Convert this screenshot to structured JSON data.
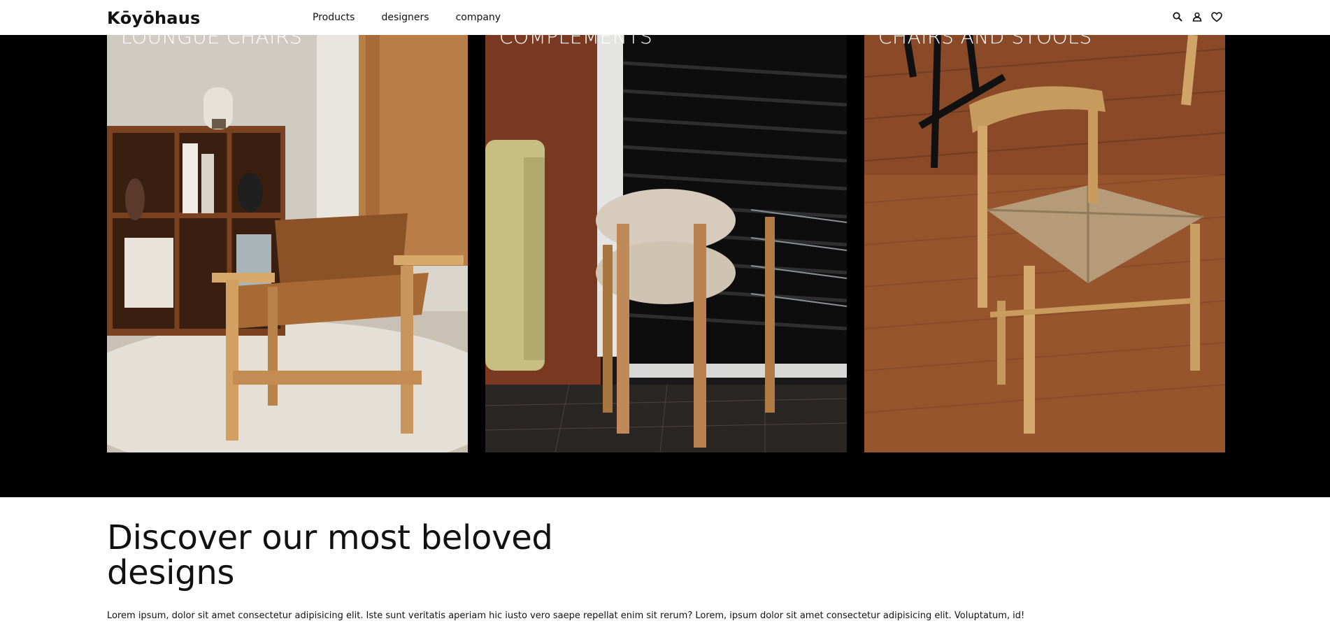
{
  "header": {
    "brand": "Kōyōhaus",
    "nav": [
      {
        "label": "Products"
      },
      {
        "label": "designers"
      },
      {
        "label": "company"
      }
    ],
    "icons": [
      "search-icon",
      "user-icon",
      "heart-icon"
    ]
  },
  "categories": [
    {
      "label": "LOUNGUE CHAIRS"
    },
    {
      "label": "COMPLEMENTS"
    },
    {
      "label": "CHAIRS AND STOOLS"
    }
  ],
  "section": {
    "headline": "Discover our most beloved designs",
    "body": "Lorem ipsum, dolor sit amet consectetur adipisicing elit. Iste sunt veritatis aperiam hic iusto vero saepe repellat enim sit rerum? Lorem, ipsum dolor sit amet consectetur adipisicing elit. Voluptatum, id!"
  },
  "colors": {
    "band": "#000000",
    "text": "#111111"
  }
}
